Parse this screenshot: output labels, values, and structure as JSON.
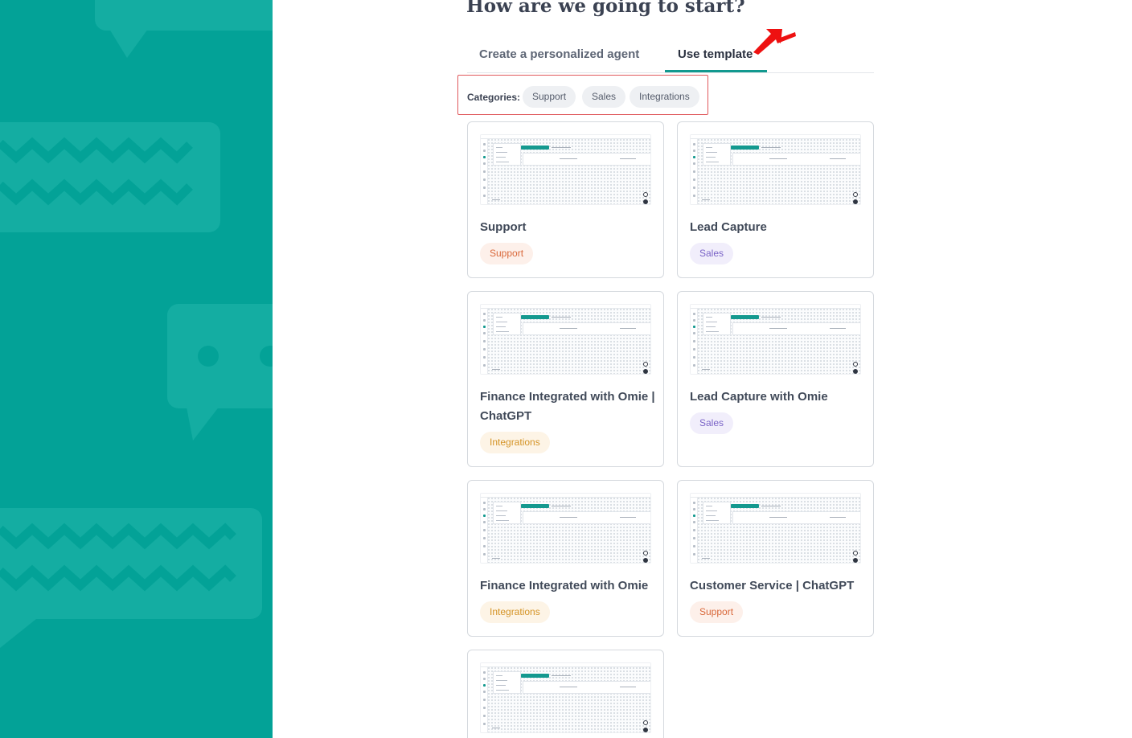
{
  "page": {
    "heading": "How are we going to start?"
  },
  "tabs": [
    {
      "label": "Create a personalized agent",
      "active": false
    },
    {
      "label": "Use template",
      "active": true
    }
  ],
  "categories": {
    "label": "Categories:",
    "items": [
      "Support",
      "Sales",
      "Integrations"
    ]
  },
  "templates": [
    {
      "title": "Support",
      "badge": "Support",
      "category": "support"
    },
    {
      "title": "Lead Capture",
      "badge": "Sales",
      "category": "sales"
    },
    {
      "title": "Finance Integrated with Omie | ChatGPT",
      "badge": "Integrations",
      "category": "integrations"
    },
    {
      "title": "Lead Capture with Omie",
      "badge": "Sales",
      "category": "sales"
    },
    {
      "title": "Finance Integrated with Omie",
      "badge": "Integrations",
      "category": "integrations"
    },
    {
      "title": "Customer Service | ChatGPT",
      "badge": "Support",
      "category": "support"
    },
    {
      "title": "",
      "badge": "",
      "category": ""
    }
  ],
  "colors": {
    "side_panel": "#03a297",
    "accent": "#12998f",
    "annotation_box": "#e0595c",
    "annotation_arrow": "#ee1111"
  }
}
